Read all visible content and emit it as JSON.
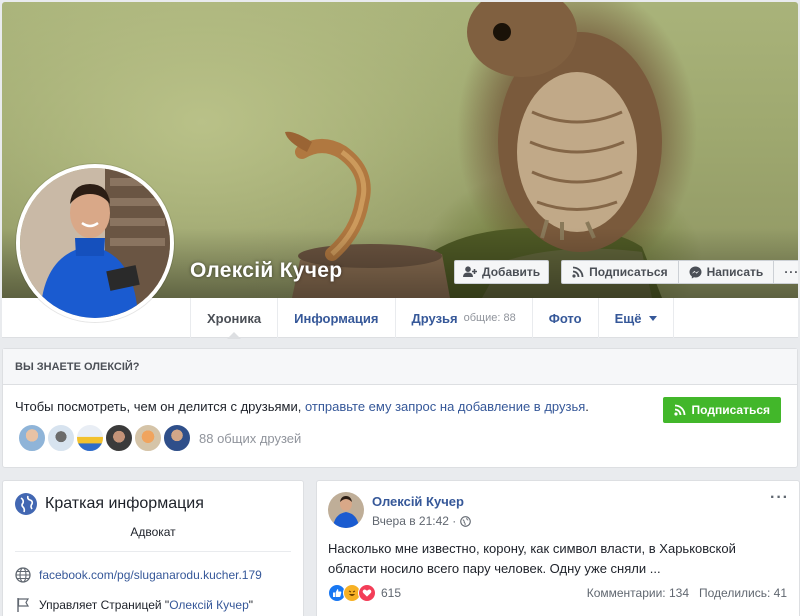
{
  "profile": {
    "name": "Олексій Кучер"
  },
  "cover_actions": {
    "add_label": "Добавить",
    "follow_label": "Подписаться",
    "message_label": "Написать",
    "more_label": "···"
  },
  "tabs": [
    {
      "label": "Хроника",
      "active": true
    },
    {
      "label": "Информация"
    },
    {
      "label": "Друзья",
      "count": "общие: 88"
    },
    {
      "label": "Фото"
    },
    {
      "label": "Ещё"
    }
  ],
  "know": {
    "header": "ВЫ ЗНАЕТЕ ОЛЕКСІЙ?",
    "text_prefix": "Чтобы посмотреть, чем он делится с друзьями,",
    "text_link": "отправьте ему запрос на добавление в друзья",
    "text_suffix": ".",
    "follow_label": "Подписаться",
    "mutual_friends": "88 общих друзей"
  },
  "intro": {
    "title": "Краткая информация",
    "subtitle": "Адвокат",
    "website": "facebook.com/pg/sluganarodu.kucher.179",
    "manages_prefix": "Управляет Страницей \"",
    "manages_link": "Олексій Кучер",
    "manages_suffix": "\""
  },
  "post": {
    "author": "Олексій Кучер",
    "time": "Вчера в 21:42 ·",
    "text": "Насколько мне известно, корону, как символ власти, в Харьковской области носило всего пару человек. Одну уже сняли ...",
    "reactions_count": "615",
    "comments": "Комментарии: 134",
    "shares": "Поделились: 41",
    "more": "···"
  },
  "colors": {
    "link": "#365899",
    "green_button": "#42b72a",
    "background": "#e9ebee"
  }
}
